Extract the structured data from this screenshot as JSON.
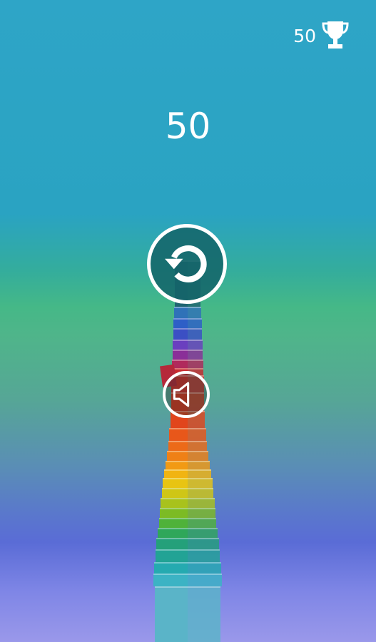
{
  "hud": {
    "best_score": "50",
    "trophy_icon": "trophy-icon"
  },
  "score": "50",
  "buttons": {
    "restart_icon": "restart-icon",
    "sound_icon": "speaker-icon"
  },
  "colors": {
    "sky_top": "#2ea5c7",
    "sky_mid": "#45b887",
    "sky_bottom": "#9a98ea",
    "restart_fill": "#14696e"
  }
}
